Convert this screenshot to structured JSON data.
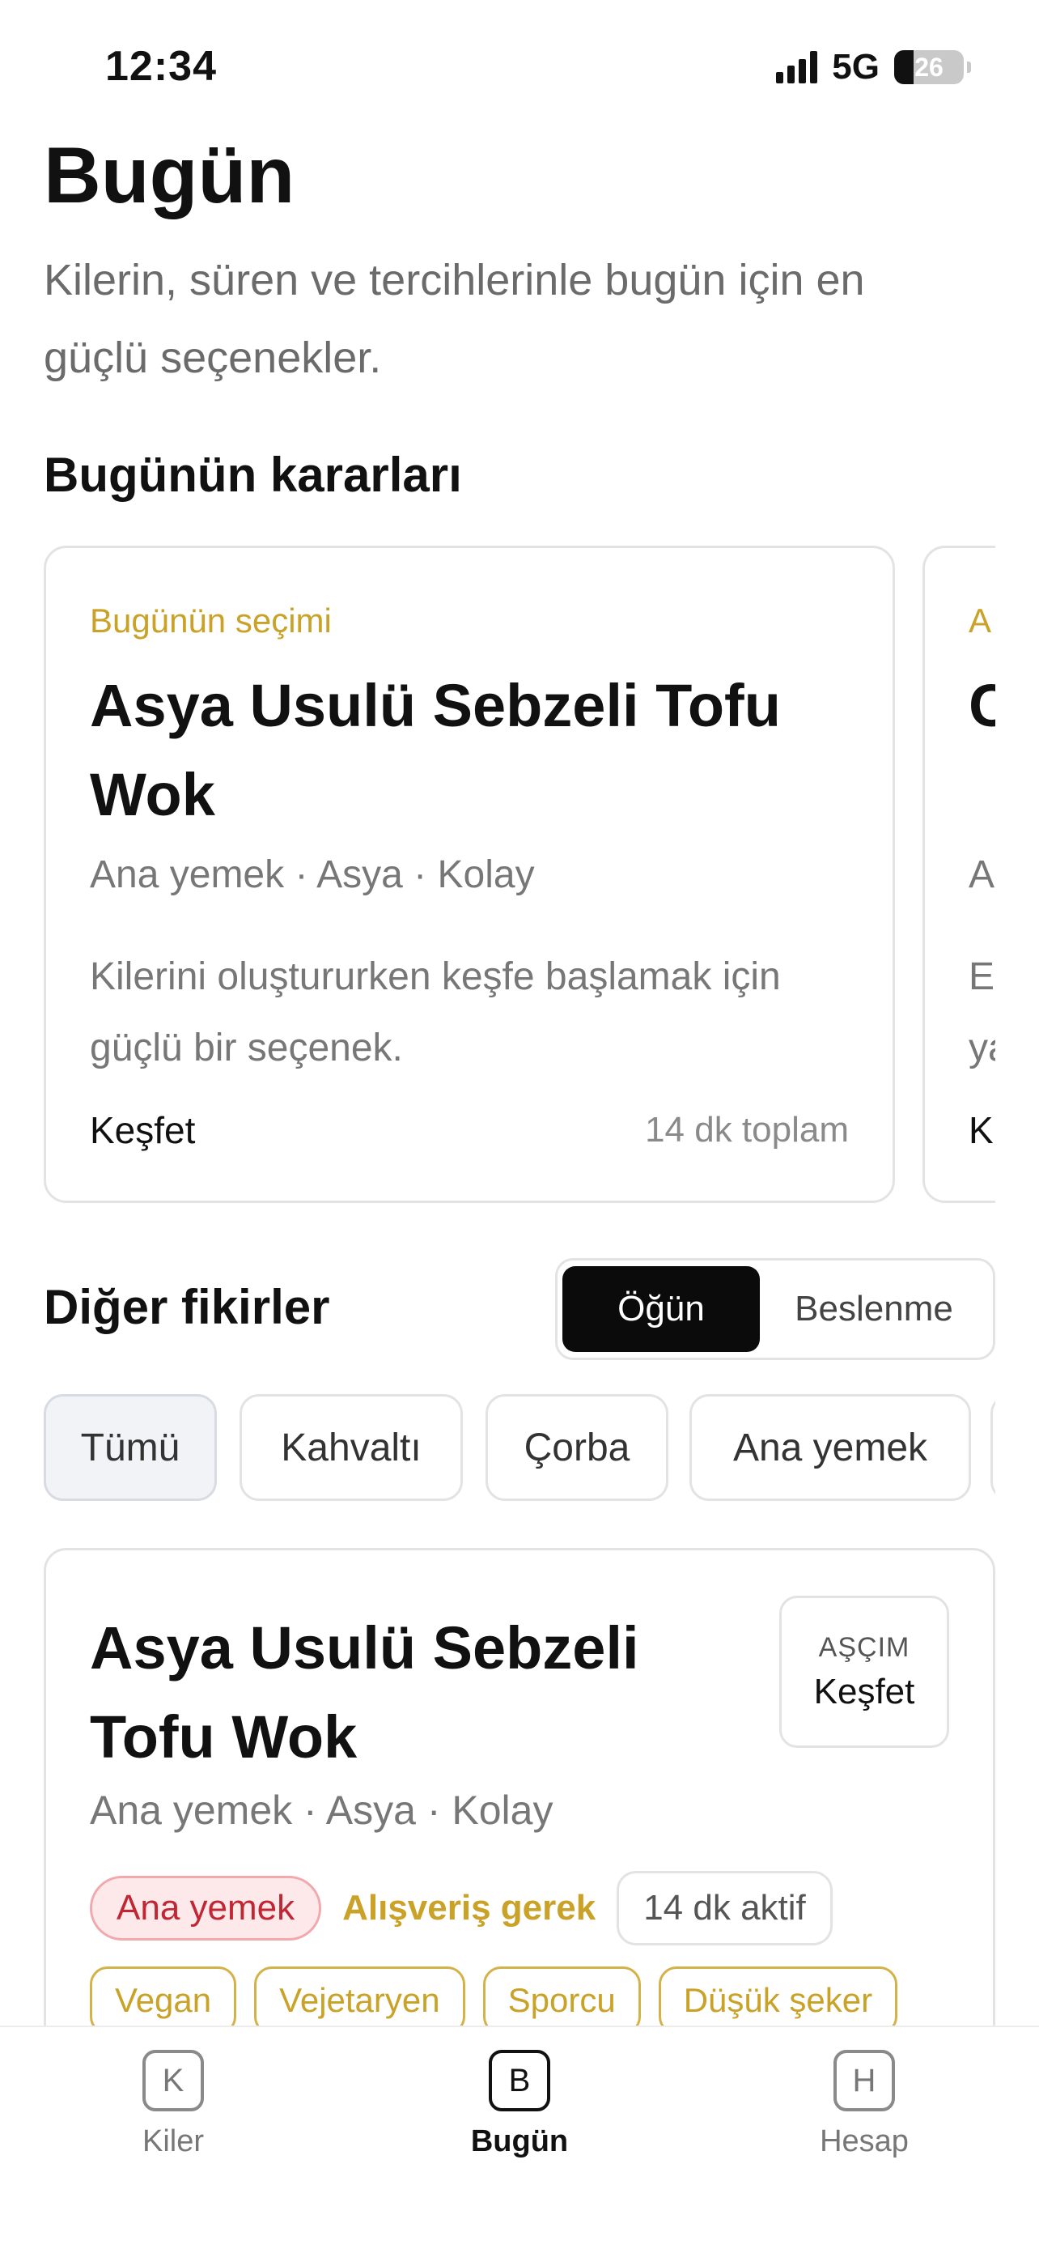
{
  "status_bar": {
    "time": "12:34",
    "network": "5G",
    "battery": "26"
  },
  "header": {
    "title": "Bugün",
    "subtitle": "Kilerin, süren ve tercihlerinle bugün için en güçlü seçenekler."
  },
  "decisions": {
    "section_title": "Bugünün kararları",
    "cards": [
      {
        "kicker": "Bugünün seçimi",
        "title": "Asya Usulü Sebzeli Tofu Wok",
        "meta": "Ana yemek · Asya · Kolay",
        "description": "Kilerini oluştururken keşfe başlamak için güçlü bir seçenek.",
        "action": "Keşfet",
        "time": "14 dk toplam"
      },
      {
        "kicker": "A",
        "title": "C",
        "meta": "A",
        "description": "E ya",
        "action": "K"
      }
    ]
  },
  "other_ideas": {
    "section_title": "Diğer fikirler",
    "segment": {
      "active": "Öğün",
      "inactive": "Beslenme"
    },
    "filters": [
      "Tümü",
      "Kahvaltı",
      "Çorba",
      "Ana yemek"
    ]
  },
  "recipe_card": {
    "title": "Asya Usulü Sebzeli Tofu Wok",
    "meta": "Ana yemek · Asya · Kolay",
    "badge_top": "AŞÇIM",
    "badge_main": "Keşfet",
    "category_tag": "Ana yemek",
    "shopping_note": "Alışveriş gerek",
    "active_time": "14 dk aktif",
    "diet_tags": [
      "Vegan",
      "Vejetaryen",
      "Sporcu",
      "Düşük şeker"
    ]
  },
  "tabbar": {
    "items": [
      {
        "icon": "K",
        "label": "Kiler"
      },
      {
        "icon": "B",
        "label": "Bugün"
      },
      {
        "icon": "H",
        "label": "Hesap"
      }
    ]
  },
  "colors": {
    "accent_gold": "#c9a227",
    "danger_red": "#c02634",
    "active_segment": "#0b0b0b",
    "muted_text": "#777777"
  }
}
